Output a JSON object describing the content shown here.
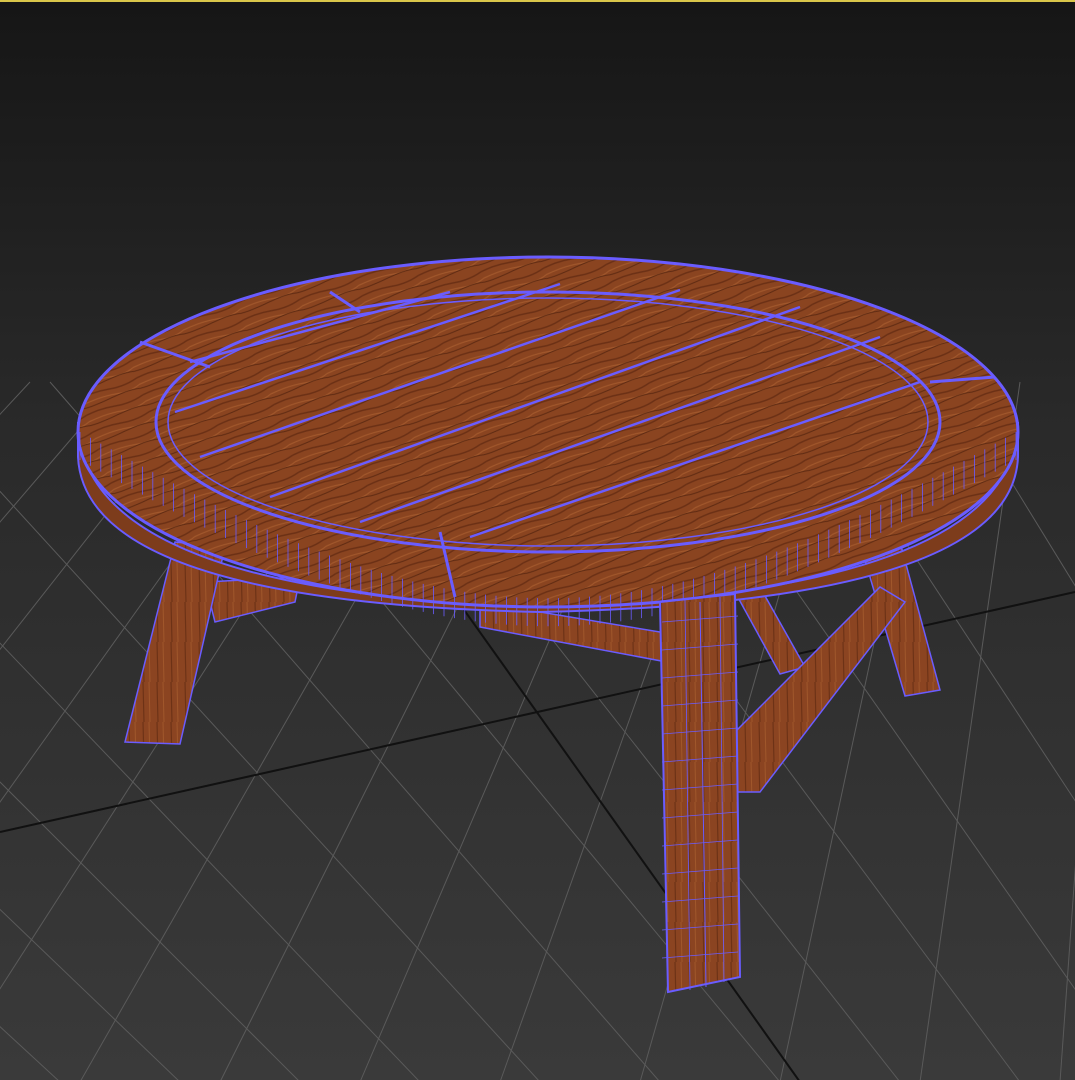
{
  "viewport": {
    "active_border_color": "#d9c64a",
    "wireframe_color": "#6a5cff",
    "wood_color": "#8a4420",
    "grid_color": "#5a5a5a",
    "grid_axis_color": "#111111"
  },
  "scene": {
    "object": "round-wooden-table",
    "display_mode": "textured-with-wireframe-overlay"
  }
}
